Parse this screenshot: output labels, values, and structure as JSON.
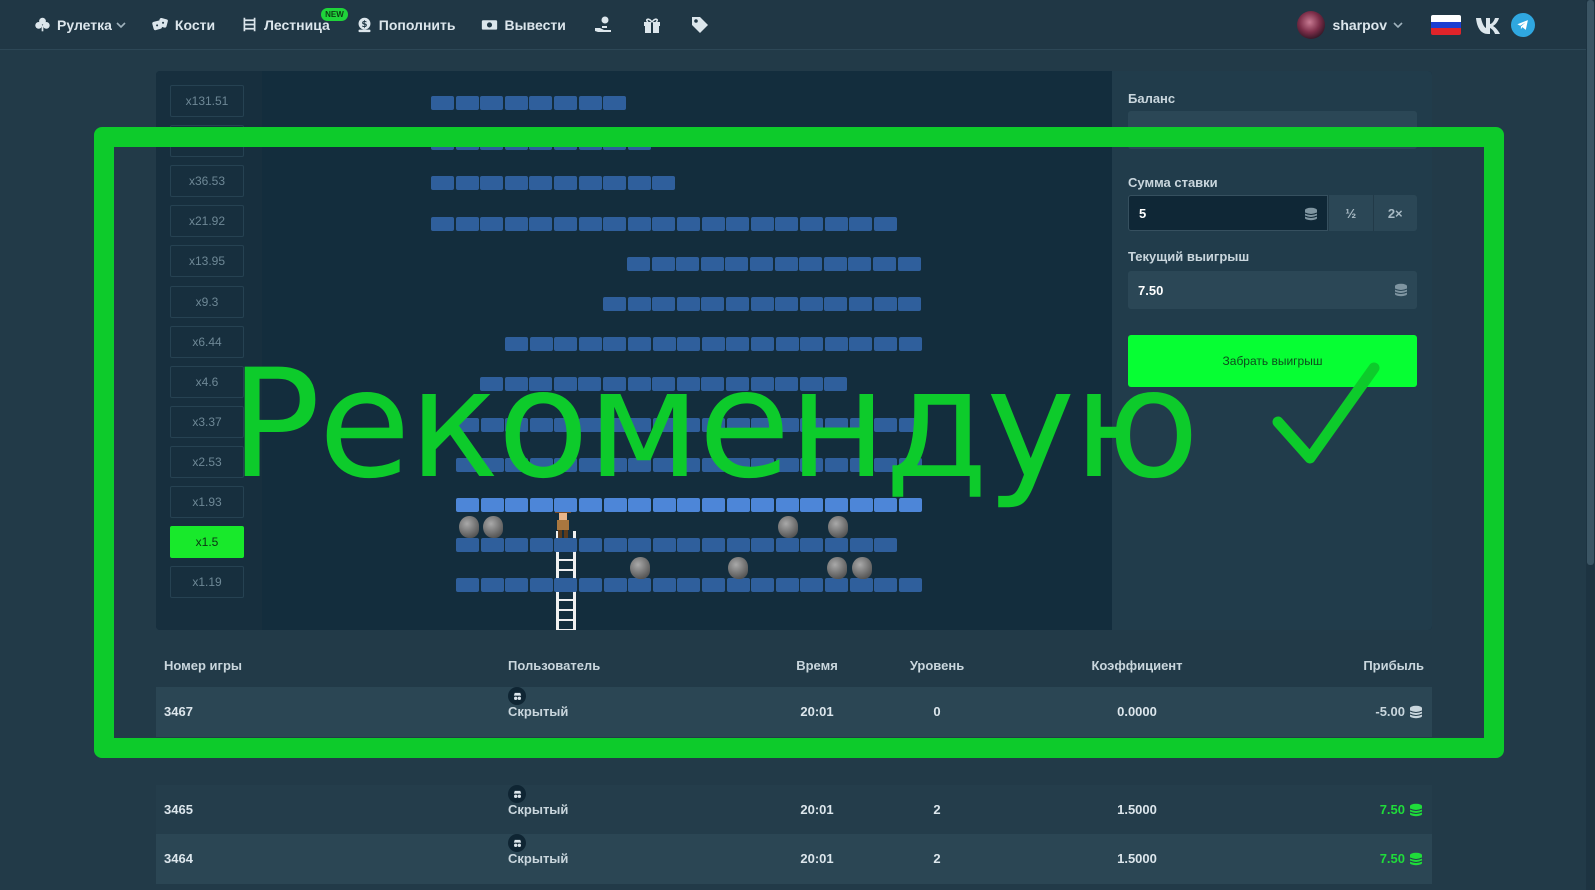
{
  "nav": {
    "items": [
      {
        "label": "Рулетка",
        "icon": "club-icon",
        "dropdown": true
      },
      {
        "label": "Кости",
        "icon": "dice-icon"
      },
      {
        "label": "Лестница",
        "icon": "ladder-icon",
        "badge": "NEW"
      },
      {
        "label": "Пополнить",
        "icon": "deposit-icon"
      },
      {
        "label": "Вывести",
        "icon": "withdraw-icon"
      }
    ],
    "icon_buttons": [
      "hand-coin-icon",
      "gift-icon",
      "tag-icon"
    ],
    "user": {
      "name": "sharpov"
    },
    "language_flag": "russia-flag-icon",
    "social": [
      "vk-icon",
      "telegram-icon"
    ]
  },
  "game": {
    "multipliers": [
      "x131.51",
      "x65.75",
      "x36.53",
      "x21.92",
      "x13.95",
      "x9.3",
      "x6.44",
      "x4.6",
      "x3.37",
      "x2.53",
      "x1.93",
      "x1.5",
      "x1.19"
    ],
    "active_multiplier": "x1.5"
  },
  "side": {
    "balance_label": "Баланс",
    "bet_label": "Сумма ставки",
    "bet_value": "5",
    "half_label": "½",
    "double_label": "2×",
    "current_win_label": "Текущий выигрыш",
    "current_win_value": "7.50",
    "cashout_label": "Забрать выигрыш"
  },
  "history": {
    "headers": {
      "id": "Номер игры",
      "user": "Пользователь",
      "time": "Время",
      "level": "Уровень",
      "coef": "Коэффициент",
      "profit": "Прибыль"
    },
    "rows": [
      {
        "id": "3467",
        "user": "Скрытый",
        "time": "20:01",
        "level": "0",
        "coef": "0.0000",
        "profit": "-5.00"
      },
      {
        "id": "3465",
        "user": "Скрытый",
        "time": "20:01",
        "level": "2",
        "coef": "1.5000",
        "profit": "7.50"
      },
      {
        "id": "3464",
        "user": "Скрытый",
        "time": "20:01",
        "level": "2",
        "coef": "1.5000",
        "profit": "7.50"
      }
    ]
  },
  "overlay": {
    "text": "Рекомендую",
    "color": "#0dcb2b"
  },
  "colors": {
    "accent_green": "#06ff33",
    "brick": "#2f5f9c",
    "brick_lit": "#4d86d8",
    "profit_positive": "#1fdc3a"
  }
}
